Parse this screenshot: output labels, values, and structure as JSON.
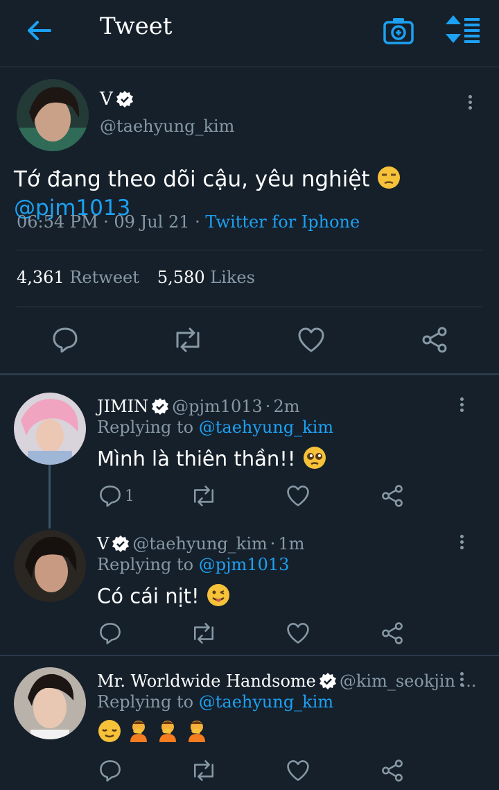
{
  "header": {
    "title": "Tweet"
  },
  "tweet": {
    "author_name": "V",
    "handle": "@taehyung_kim",
    "text": "Tớ đang theo dõi cậu, yêu nghiệt",
    "mention": "@pjm1013",
    "time": "06:54 PM",
    "date": "09 Jul 21",
    "source": "Twitter for Iphone",
    "retweets_count": "4,361",
    "retweets_label": "Retweet",
    "likes_count": "5,580",
    "likes_label": "Likes"
  },
  "replies": [
    {
      "name": "JIMIN",
      "handle": "@pjm1013",
      "age": "2m",
      "replying_label": "Replying to",
      "replying_to": "@taehyung_kim",
      "text": "Mình là thiên thần!!",
      "reply_count": "1"
    },
    {
      "name": "V",
      "handle": "@taehyung_kim",
      "age": "1m",
      "replying_label": "Replying to",
      "replying_to": "@pjm1013",
      "text": "Có cái nịt!"
    },
    {
      "name": "Mr. Worldwide Handsome",
      "handle": "@kim_seokjin ...",
      "replying_label": "Replying to",
      "replying_to": "@taehyung_kim"
    }
  ],
  "colors": {
    "background": "#15202b",
    "accent": "#1da1f2",
    "muted": "#8899a6",
    "divider": "#2b3a49"
  }
}
